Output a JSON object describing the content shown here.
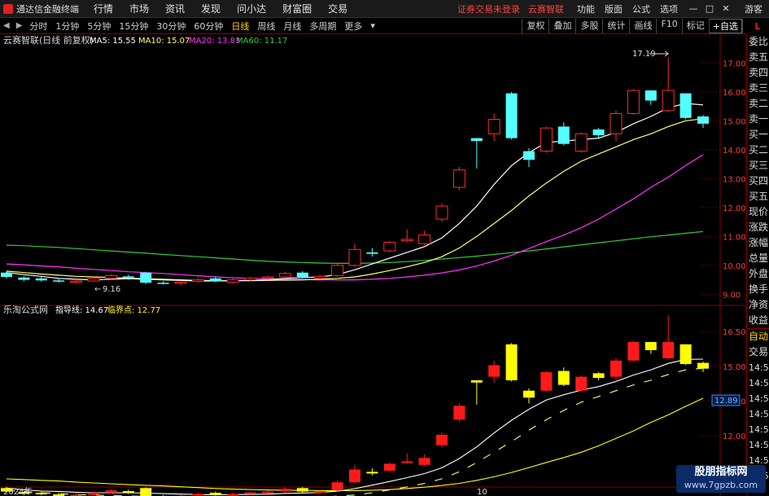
{
  "menubar": {
    "app_title": "通达信金融终端",
    "menus": [
      "行情",
      "市场",
      "资讯",
      "发现",
      "问小达",
      "财富圈",
      "交易"
    ],
    "links": [
      "证券交易未登录",
      "云赛智联"
    ],
    "tools": [
      "功能",
      "版面",
      "公式",
      "选项"
    ],
    "window": [
      "—",
      "□",
      "✕"
    ],
    "guest": "游客"
  },
  "periodbar": {
    "periods": [
      "分时",
      "1分钟",
      "5分钟",
      "15分钟",
      "30分钟",
      "60分钟",
      "日线",
      "周线",
      "月线",
      "多周期",
      "更多"
    ],
    "active": "日线",
    "tools": [
      "复权",
      "叠加",
      "多股",
      "统计",
      "画线",
      "F10",
      "标记"
    ],
    "self_select": "+自选",
    "back": "返回",
    "mark": "L"
  },
  "main": {
    "stock": "云赛智联(日线 前复权)",
    "ma5": "MA5: 15.55",
    "ma10": "MA10: 15.07",
    "ma20": "MA20: 13.83",
    "ma60": "MA60: 11.17",
    "high_note": "17.19",
    "low_note": "9.16",
    "yaxis": [
      "17.00",
      "16.00",
      "15.00",
      "14.00",
      "13.00",
      "12.00",
      "11.00",
      "10.00",
      "9.00"
    ]
  },
  "sub": {
    "title": "乐淘公式网",
    "guide": "指导线: 14.67",
    "critical": "临界点: 12.77",
    "yaxis": [
      "16.50",
      "15.00",
      "13.50",
      "12.00",
      "10.50"
    ],
    "current": "12.89"
  },
  "xaxis": {
    "labels": [
      "2024年",
      "9",
      "10"
    ]
  },
  "rightpanel": {
    "upper": [
      "委比",
      "卖五",
      "卖四",
      "卖三",
      "卖二",
      "卖一",
      "买一",
      "买二",
      "买三",
      "买四",
      "买五",
      "现价",
      "涨跌",
      "涨幅",
      "总量",
      "外盘",
      "换手",
      "净资",
      "收益"
    ],
    "lower_label": "自动",
    "lower_trade": "交易",
    "times": [
      "14:56",
      "14:56",
      "14:56",
      "14:56",
      "14:56",
      "14:56",
      "14:56",
      "14:56"
    ]
  },
  "watermark": {
    "line1": "股朋指标网",
    "line2": "www.7gpzb.com"
  },
  "colors": {
    "up": "#ff2b2b",
    "down": "#54ffff",
    "ma5": "#ffffff",
    "ma10": "#ffff77",
    "ma20": "#ff33ff",
    "ma60": "#33cc33",
    "sub_up": "#ff1a1a",
    "sub_down": "#ffff00"
  },
  "chart_data": {
    "type": "candlestick",
    "title": "云赛智联(日线 前复权)",
    "ylim": [
      8.7,
      17.6
    ],
    "candles": [
      {
        "o": 9.75,
        "c": 9.6,
        "h": 9.8,
        "l": 9.55
      },
      {
        "o": 9.58,
        "c": 9.5,
        "h": 9.62,
        "l": 9.45
      },
      {
        "o": 9.55,
        "c": 9.48,
        "h": 9.6,
        "l": 9.44
      },
      {
        "o": 9.48,
        "c": 9.45,
        "h": 9.55,
        "l": 9.4
      },
      {
        "o": 9.43,
        "c": 9.46,
        "h": 9.52,
        "l": 9.38
      },
      {
        "o": 9.46,
        "c": 9.55,
        "h": 9.6,
        "l": 9.42
      },
      {
        "o": 9.55,
        "c": 9.65,
        "h": 9.7,
        "l": 9.52
      },
      {
        "o": 9.62,
        "c": 9.58,
        "h": 9.68,
        "l": 9.5
      },
      {
        "o": 9.75,
        "c": 9.4,
        "h": 9.78,
        "l": 9.35
      },
      {
        "o": 9.4,
        "c": 9.38,
        "h": 9.45,
        "l": 9.34
      },
      {
        "o": 9.38,
        "c": 9.42,
        "h": 9.48,
        "l": 9.32
      },
      {
        "o": 9.45,
        "c": 9.5,
        "h": 9.55,
        "l": 9.4
      },
      {
        "o": 9.55,
        "c": 9.45,
        "h": 9.6,
        "l": 9.42
      },
      {
        "o": 9.42,
        "c": 9.5,
        "h": 9.55,
        "l": 9.38
      },
      {
        "o": 9.5,
        "c": 9.56,
        "h": 9.6,
        "l": 9.46
      },
      {
        "o": 9.56,
        "c": 9.6,
        "h": 9.65,
        "l": 9.5
      },
      {
        "o": 9.6,
        "c": 9.72,
        "h": 9.78,
        "l": 9.55
      },
      {
        "o": 9.75,
        "c": 9.6,
        "h": 9.8,
        "l": 9.55
      },
      {
        "o": 9.55,
        "c": 9.62,
        "h": 9.68,
        "l": 9.52
      },
      {
        "o": 9.65,
        "c": 10.0,
        "h": 10.1,
        "l": 9.6
      },
      {
        "o": 10.0,
        "c": 10.55,
        "h": 10.75,
        "l": 9.95
      },
      {
        "o": 10.45,
        "c": 10.4,
        "h": 10.6,
        "l": 10.3
      },
      {
        "o": 10.5,
        "c": 10.8,
        "h": 10.85,
        "l": 10.45
      },
      {
        "o": 10.85,
        "c": 10.9,
        "h": 11.25,
        "l": 10.8
      },
      {
        "o": 10.75,
        "c": 11.05,
        "h": 11.2,
        "l": 10.7
      },
      {
        "o": 11.6,
        "c": 12.05,
        "h": 12.15,
        "l": 11.5
      },
      {
        "o": 12.7,
        "c": 13.3,
        "h": 13.4,
        "l": 12.6
      },
      {
        "o": 14.4,
        "c": 14.3,
        "h": 14.4,
        "l": 13.35
      },
      {
        "o": 14.55,
        "c": 15.05,
        "h": 15.25,
        "l": 14.3
      },
      {
        "o": 15.95,
        "c": 14.4,
        "h": 16.0,
        "l": 14.35
      },
      {
        "o": 13.95,
        "c": 13.65,
        "h": 14.05,
        "l": 13.4
      },
      {
        "o": 13.95,
        "c": 14.75,
        "h": 14.8,
        "l": 13.9
      },
      {
        "o": 14.8,
        "c": 14.2,
        "h": 14.95,
        "l": 14.15
      },
      {
        "o": 13.95,
        "c": 14.55,
        "h": 14.6,
        "l": 13.9
      },
      {
        "o": 14.7,
        "c": 14.5,
        "h": 14.75,
        "l": 14.4
      },
      {
        "o": 14.55,
        "c": 15.25,
        "h": 15.35,
        "l": 14.3
      },
      {
        "o": 15.25,
        "c": 16.05,
        "h": 16.1,
        "l": 15.2
      },
      {
        "o": 16.05,
        "c": 15.7,
        "h": 16.05,
        "l": 15.55
      },
      {
        "o": 15.35,
        "c": 16.05,
        "h": 17.19,
        "l": 15.3
      },
      {
        "o": 15.95,
        "c": 15.1,
        "h": 15.95,
        "l": 15.05
      },
      {
        "o": 15.15,
        "c": 14.9,
        "h": 15.2,
        "l": 14.75
      }
    ],
    "ma5": [
      9.75,
      9.68,
      9.62,
      9.55,
      9.52,
      9.5,
      9.52,
      9.54,
      9.52,
      9.5,
      9.48,
      9.46,
      9.46,
      9.47,
      9.48,
      9.5,
      9.55,
      9.58,
      9.6,
      9.68,
      9.85,
      10.05,
      10.25,
      10.45,
      10.65,
      10.95,
      11.45,
      12.05,
      12.8,
      13.45,
      13.9,
      14.25,
      14.3,
      14.35,
      14.4,
      14.6,
      14.9,
      15.15,
      15.45,
      15.6,
      15.55
    ],
    "ma10": [
      9.8,
      9.75,
      9.7,
      9.66,
      9.62,
      9.6,
      9.58,
      9.56,
      9.54,
      9.52,
      9.5,
      9.48,
      9.47,
      9.47,
      9.47,
      9.48,
      9.49,
      9.5,
      9.52,
      9.55,
      9.6,
      9.7,
      9.82,
      9.95,
      10.1,
      10.3,
      10.6,
      11.0,
      11.45,
      11.9,
      12.4,
      12.85,
      13.25,
      13.6,
      13.85,
      14.1,
      14.35,
      14.55,
      14.8,
      15.0,
      15.07
    ],
    "ma20": [
      10.05,
      10.02,
      9.98,
      9.95,
      9.9,
      9.86,
      9.82,
      9.78,
      9.75,
      9.72,
      9.68,
      9.64,
      9.6,
      9.57,
      9.55,
      9.53,
      9.52,
      9.51,
      9.5,
      9.5,
      9.5,
      9.52,
      9.55,
      9.6,
      9.66,
      9.74,
      9.84,
      9.98,
      10.15,
      10.35,
      10.58,
      10.82,
      11.05,
      11.3,
      11.6,
      11.95,
      12.3,
      12.7,
      13.05,
      13.45,
      13.83
    ],
    "ma60": [
      10.7,
      10.68,
      10.65,
      10.62,
      10.58,
      10.54,
      10.5,
      10.46,
      10.42,
      10.38,
      10.34,
      10.3,
      10.26,
      10.22,
      10.18,
      10.14,
      10.12,
      10.1,
      10.08,
      10.07,
      10.07,
      10.08,
      10.1,
      10.13,
      10.17,
      10.22,
      10.27,
      10.32,
      10.38,
      10.44,
      10.5,
      10.57,
      10.64,
      10.71,
      10.78,
      10.85,
      10.92,
      10.99,
      11.05,
      11.11,
      11.17
    ]
  }
}
